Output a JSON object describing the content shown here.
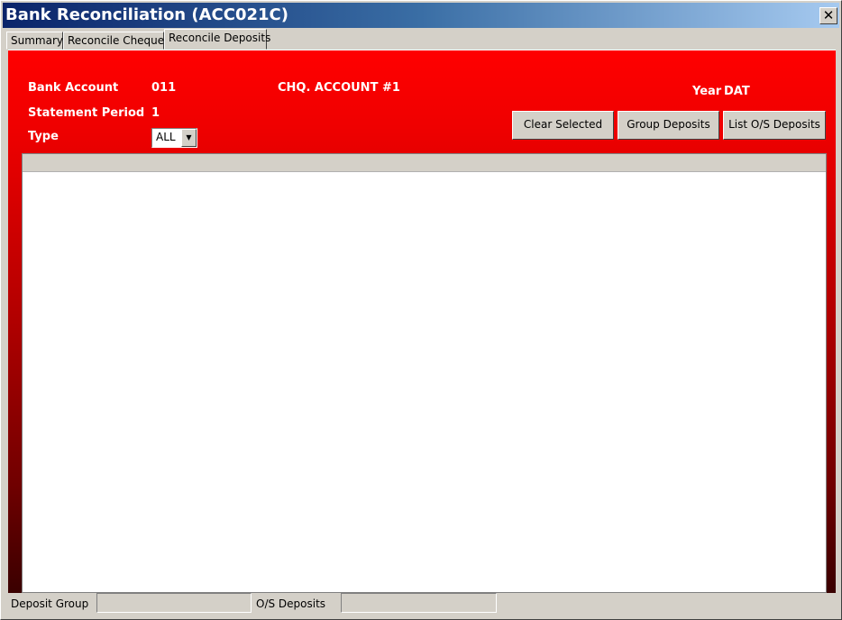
{
  "window": {
    "title": "Bank Reconciliation (ACC021C)",
    "close_glyph": "✕"
  },
  "tabs": [
    {
      "label": "Summary"
    },
    {
      "label": "Reconcile Cheques"
    },
    {
      "label": "Reconcile Deposits"
    }
  ],
  "form": {
    "bank_account_label": "Bank Account",
    "bank_account_value": "011",
    "account_name": "CHQ. ACCOUNT #1",
    "statement_period_label": "Statement Period",
    "statement_period_value": "1",
    "type_label": "Type",
    "type_value": "ALL",
    "year_label": "Year",
    "year_value": "DAT"
  },
  "buttons": {
    "clear_selected": "Clear Selected",
    "group_deposits": "Group Deposits",
    "list_os_deposits": "List O/S Deposits"
  },
  "status": {
    "deposit_group_label": "Deposit Group",
    "deposit_group_value": "",
    "os_deposits_label": "O/S Deposits",
    "os_deposits_value": ""
  },
  "colors": {
    "panel_top": "#ff0000",
    "panel_bottom": "#3a0000",
    "titlebar_start": "#0a246a",
    "titlebar_end": "#a6caf0"
  }
}
